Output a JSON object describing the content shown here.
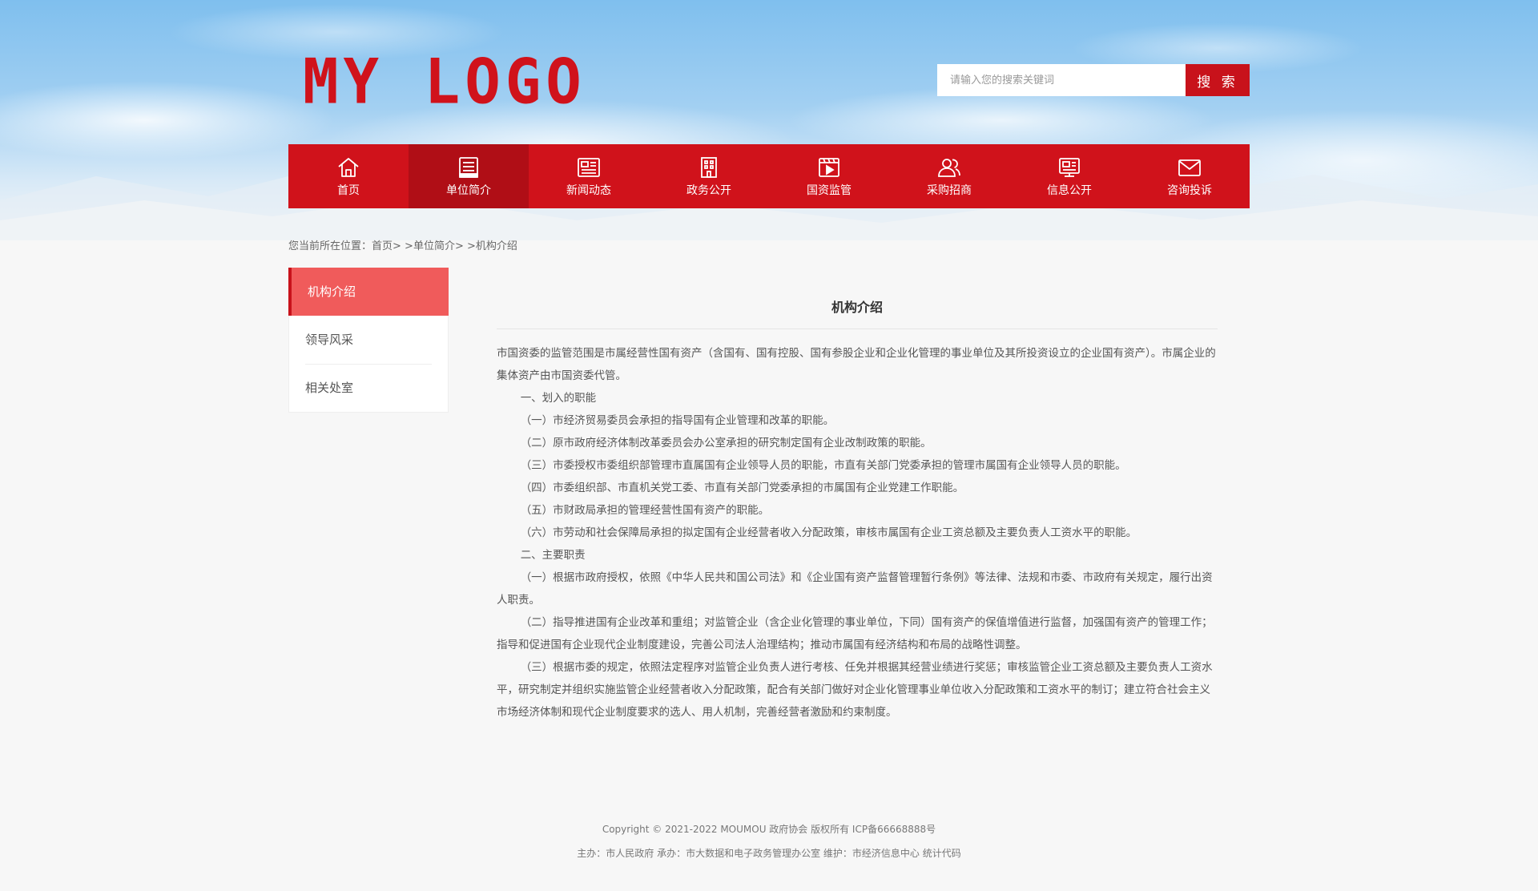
{
  "header": {
    "logo_text": "MY LOGO",
    "search_placeholder": "请输入您的搜索关键词",
    "search_button": "搜 索"
  },
  "nav": {
    "items": [
      {
        "label": "首页",
        "icon": "home-icon"
      },
      {
        "label": "单位简介",
        "icon": "document-list-icon",
        "active": true
      },
      {
        "label": "新闻动态",
        "icon": "newspaper-icon"
      },
      {
        "label": "政务公开",
        "icon": "building-icon"
      },
      {
        "label": "国资监管",
        "icon": "video-play-icon"
      },
      {
        "label": "采购招商",
        "icon": "users-icon"
      },
      {
        "label": "信息公开",
        "icon": "info-board-icon"
      },
      {
        "label": "咨询投诉",
        "icon": "envelope-icon"
      }
    ]
  },
  "breadcrumb": {
    "prefix": "您当前所在位置：",
    "home": "首页",
    "sep1": "> >",
    "section": "单位简介",
    "sep2": "> >",
    "current": "机构介绍"
  },
  "sidebar": {
    "items": [
      {
        "label": "机构介绍",
        "active": true
      },
      {
        "label": "领导风采"
      },
      {
        "label": "相关处室"
      }
    ]
  },
  "article": {
    "title": "机构介绍",
    "paragraphs": [
      " 市国资委的监管范围是市属经营性国有资产（含国有、国有控股、国有参股企业和企业化管理的事业单位及其所投资设立的企业国有资产）。市属企业的集体资产由市国资委代管。",
      "一、划入的职能",
      "（一）市经济贸易委员会承担的指导国有企业管理和改革的职能。",
      "（二）原市政府经济体制改革委员会办公室承担的研究制定国有企业改制政策的职能。",
      "（三）市委授权市委组织部管理市直属国有企业领导人员的职能，市直有关部门党委承担的管理市属国有企业领导人员的职能。",
      "（四）市委组织部、市直机关党工委、市直有关部门党委承担的市属国有企业党建工作职能。",
      "（五）市财政局承担的管理经营性国有资产的职能。",
      "（六）市劳动和社会保障局承担的拟定国有企业经营者收入分配政策，审核市属国有企业工资总额及主要负责人工资水平的职能。",
      "二、主要职责",
      "（一）根据市政府授权，依照《中华人民共和国公司法》和《企业国有资产监督管理暂行条例》等法律、法规和市委、市政府有关规定，履行出资人职责。",
      "（二）指导推进国有企业改革和重组；对监管企业（含企业化管理的事业单位，下同）国有资产的保值增值进行监督，加强国有资产的管理工作；指导和促进国有企业现代企业制度建设，完善公司法人治理结构；推动市属国有经济结构和布局的战略性调整。",
      "（三）根据市委的规定，依照法定程序对监管企业负责人进行考核、任免并根据其经营业绩进行奖惩；审核监管企业工资总额及主要负责人工资水平，研究制定并组织实施监管企业经营者收入分配政策，配合有关部门做好对企业化管理事业单位收入分配政策和工资水平的制订；建立符合社会主义市场经济体制和现代企业制度要求的选人、用人机制，完善经营者激励和约束制度。"
    ]
  },
  "footer": {
    "line1": "Copyright © 2021-2022 MOUMOU 政府协会 版权所有 ICP备66668888号",
    "line2": "主办：市人民政府 承办：市大数据和电子政务管理办公室 维护：市经济信息中心 统计代码"
  },
  "colors": {
    "brand_red": "#d0121b",
    "nav_active": "#b00e16",
    "sidebar_active": "#f05b5b"
  }
}
